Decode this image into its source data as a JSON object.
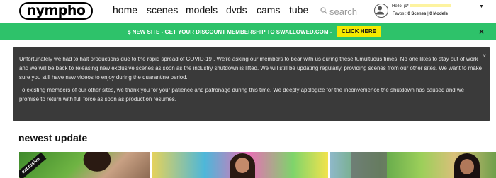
{
  "header": {
    "logo": "nympho",
    "nav": [
      "home",
      "scenes",
      "models",
      "dvds",
      "cams",
      "tube"
    ],
    "search_placeholder": "search",
    "user": {
      "hello": "Hello, jc*",
      "favs_label": "Favos :",
      "favs_scenes": "0 Scenes",
      "favs_sep": "|",
      "favs_models": "0 Models"
    }
  },
  "promo": {
    "text": "$ NEW SITE - GET YOUR DISCOUNT MEMBERSHIP TO SWALLOWED.COM -",
    "button": "CLICK HERE",
    "close": "×"
  },
  "notice": {
    "close": "×",
    "paragraph1": "Unfortunately we had to halt productions due to the rapid spread of COVID-19 . We're asking our members to bear with us during these tumultuous times. No one likes to stay out of work and we will be back to releasing new exclusive scenes as soon as the industry shutdown is lifted. We will still be updating regularly, providing scenes from our other sites. We want to make sure you still have new videos to enjoy during the quarantine period.",
    "paragraph2": "To existing members of our other sites, we thank you for your patience and patronage during this time. We deeply apologize for the inconvenience the shutdown has caused and we promise to return with full force as soon as production resumes."
  },
  "newest": {
    "title": "newest update",
    "badge": "exclusive"
  },
  "colors": {
    "promo_bg": "#2ec26a",
    "button_bg": "#f6e900",
    "notice_bg": "#3a3a3a"
  }
}
